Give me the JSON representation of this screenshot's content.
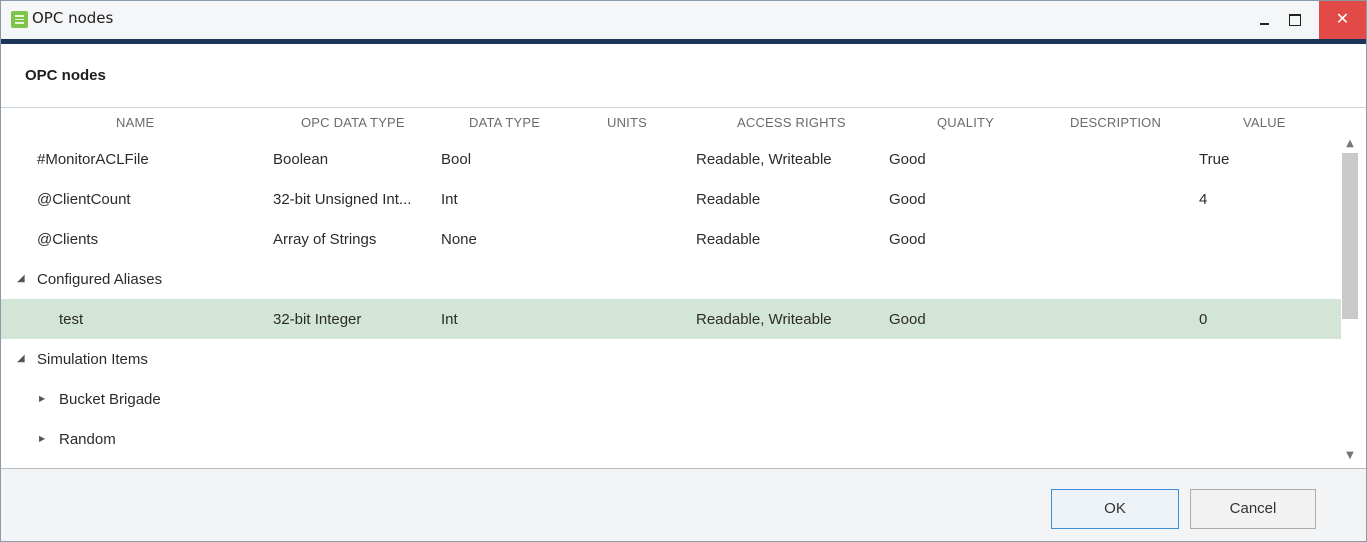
{
  "window": {
    "title": "OPC nodes",
    "close_glyph": "✕"
  },
  "header": {
    "title": "OPC nodes"
  },
  "columns": [
    "NAME",
    "OPC DATA TYPE",
    "DATA TYPE",
    "UNITS",
    "ACCESS RIGHTS",
    "QUALITY",
    "DESCRIPTION",
    "VALUE"
  ],
  "rows": [
    {
      "name": "#MonitorACLFile",
      "opc_type": "Boolean",
      "data_type": "Bool",
      "units": "",
      "access": "Readable, Writeable",
      "quality": "Good",
      "description": "",
      "value": "True"
    },
    {
      "name": "@ClientCount",
      "opc_type": "32-bit Unsigned Int...",
      "data_type": "Int",
      "units": "",
      "access": "Readable",
      "quality": "Good",
      "description": "",
      "value": "4"
    },
    {
      "name": "@Clients",
      "opc_type": "Array of Strings",
      "data_type": "None",
      "units": "",
      "access": "Readable",
      "quality": "Good",
      "description": "",
      "value": ""
    },
    {
      "name": "Configured Aliases",
      "expander": "◢",
      "expanded": true
    },
    {
      "name": "test",
      "opc_type": "32-bit Integer",
      "data_type": "Int",
      "units": "",
      "access": "Readable, Writeable",
      "quality": "Good",
      "description": "",
      "value": "0",
      "selected": true
    },
    {
      "name": "Simulation Items",
      "expander": "◢",
      "expanded": true
    },
    {
      "name": "Bucket Brigade",
      "expander": "▶",
      "expanded": false
    },
    {
      "name": "Random",
      "expander": "▶",
      "expanded": false
    }
  ],
  "scrollbar": {
    "up_glyph": "▲",
    "down_glyph": "▼"
  },
  "footer": {
    "ok_label": "OK",
    "cancel_label": "Cancel"
  },
  "colors": {
    "selected_row": "#d2e5d6",
    "title_close": "#e14a47",
    "top_line": "#1b3558",
    "ok_border": "#3e8fd8"
  }
}
